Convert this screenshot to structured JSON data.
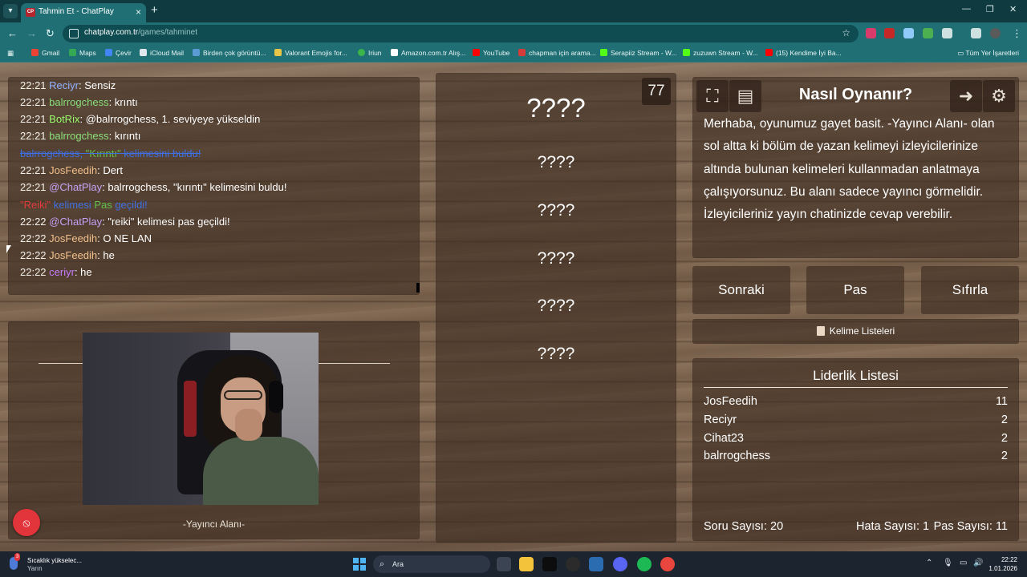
{
  "browser": {
    "tab_title": "Tahmin Et - ChatPlay",
    "tab_favicon": "CP",
    "url_host": "chatplay.com.tr",
    "url_path": "/games/tahminet",
    "new_tab_glyph": "+",
    "bookmarks": [
      {
        "label": "Gmail",
        "icon_color": "#ea4335"
      },
      {
        "label": "Maps",
        "icon_color": "#34a853"
      },
      {
        "label": "Çevir",
        "icon_color": "#4285f4"
      },
      {
        "label": "iCloud Mail",
        "icon_color": "#dfe6ee"
      },
      {
        "label": "Birden çok görüntü...",
        "icon_color": "#5b9bd5"
      },
      {
        "label": "Valorant Emojis for...",
        "icon_color": "#e8c547"
      },
      {
        "label": "Iriun",
        "icon_color": "#3bb54a"
      },
      {
        "label": "Amazon.com.tr Alış...",
        "icon_color": "#ffffff"
      },
      {
        "label": "YouTube",
        "icon_color": "#ff0000"
      },
      {
        "label": "chapman için arama...",
        "icon_color": "#d43b3b"
      },
      {
        "label": "Serapiiz Stream - W...",
        "icon_color": "#53fc18"
      },
      {
        "label": "zuzuwn Stream - W...",
        "icon_color": "#53fc18"
      },
      {
        "label": "(15) Kendime İyi Ba...",
        "icon_color": "#ff0000"
      }
    ],
    "bookmarks_folder": "Tüm Yer İşaretleri"
  },
  "chat": {
    "lines": [
      {
        "time": "22:21",
        "user": "Reciyr",
        "user_class": "u-reciyr",
        "msg": ": Sensiz"
      },
      {
        "time": "22:21",
        "user": "balrrogchess",
        "user_class": "u-balr",
        "msg": ": krıntı"
      },
      {
        "time": "22:21",
        "user": "BotRix",
        "user_class": "u-botrix",
        "msg": ": @balrrogchess, 1. seviyeye yükseldin"
      },
      {
        "time": "22:21",
        "user": "balrrogchess",
        "user_class": "u-balr",
        "msg": ": kırıntı"
      },
      {
        "time": "22:21",
        "user": "JosFeedih",
        "user_class": "u-jos",
        "msg": ": Dert"
      },
      {
        "time": "22:21",
        "user": "@ChatPlay",
        "user_class": "u-chat",
        "msg": ": balrrogchess, \"kırıntı\" kelimesini buldu!"
      },
      {
        "time": "22:22",
        "user": "@ChatPlay",
        "user_class": "u-chat",
        "msg": ": \"reiki\" kelimesi pas geçildi!"
      },
      {
        "time": "22:22",
        "user": "JosFeedih",
        "user_class": "u-jos",
        "msg": ": O NE LAN"
      },
      {
        "time": "22:22",
        "user": "JosFeedih",
        "user_class": "u-jos",
        "msg": ": he"
      },
      {
        "time": "22:22",
        "user": "ceriyr",
        "user_class": "u-ceriyr",
        "msg": ": he"
      }
    ],
    "system_found": {
      "user": "balrrogchess",
      "sep": ", ",
      "word": "\"Kırıntı\"",
      "rest": " kelimesini buldu!"
    },
    "system_pass": {
      "word": "\"Reiki\"",
      "mid": " kelimesi ",
      "pas": "Pas",
      "rest": " geçildi!"
    }
  },
  "streamer": {
    "label": "-Yayıncı Alanı-",
    "live_icon": "⦸"
  },
  "words": {
    "counter": "77",
    "main": "????",
    "list": [
      "????",
      "????",
      "????",
      "????",
      "????"
    ]
  },
  "howto": {
    "title": "Nasıl Oynanır?",
    "text": "Merhaba, oyunumuz gayet basit. -Yayıncı Alanı- olan sol altta ki bölüm de yazan kelimeyi izleyicilerinize altında bulunan kelimeleri kullanmadan anlatmaya çalışıyorsunuz. Bu alanı sadece yayıncı görmelidir. İzleyicileriniz yayın chatinizde cevap verebilir."
  },
  "controls": {
    "next": "Sonraki",
    "pass": "Pas",
    "reset": "Sıfırla",
    "word_lists": "Kelime Listeleri"
  },
  "leaderboard": {
    "title": "Liderlik Listesi",
    "rows": [
      {
        "name": "JosFeedih",
        "score": "11"
      },
      {
        "name": "Reciyr",
        "score": "2"
      },
      {
        "name": "Cihat23",
        "score": "2"
      },
      {
        "name": "balrrogchess",
        "score": "2"
      }
    ],
    "questions": "Soru Sayısı: 20",
    "errors": "Hata Sayısı: 1",
    "passes": "Pas Sayısı: 11"
  },
  "taskbar": {
    "weather_title": "Sıcaklık yükselec...",
    "weather_sub": "Yarın",
    "weather_badge": "3",
    "search_placeholder": "Ara",
    "time": "22:22",
    "date": "1.01.2026"
  }
}
